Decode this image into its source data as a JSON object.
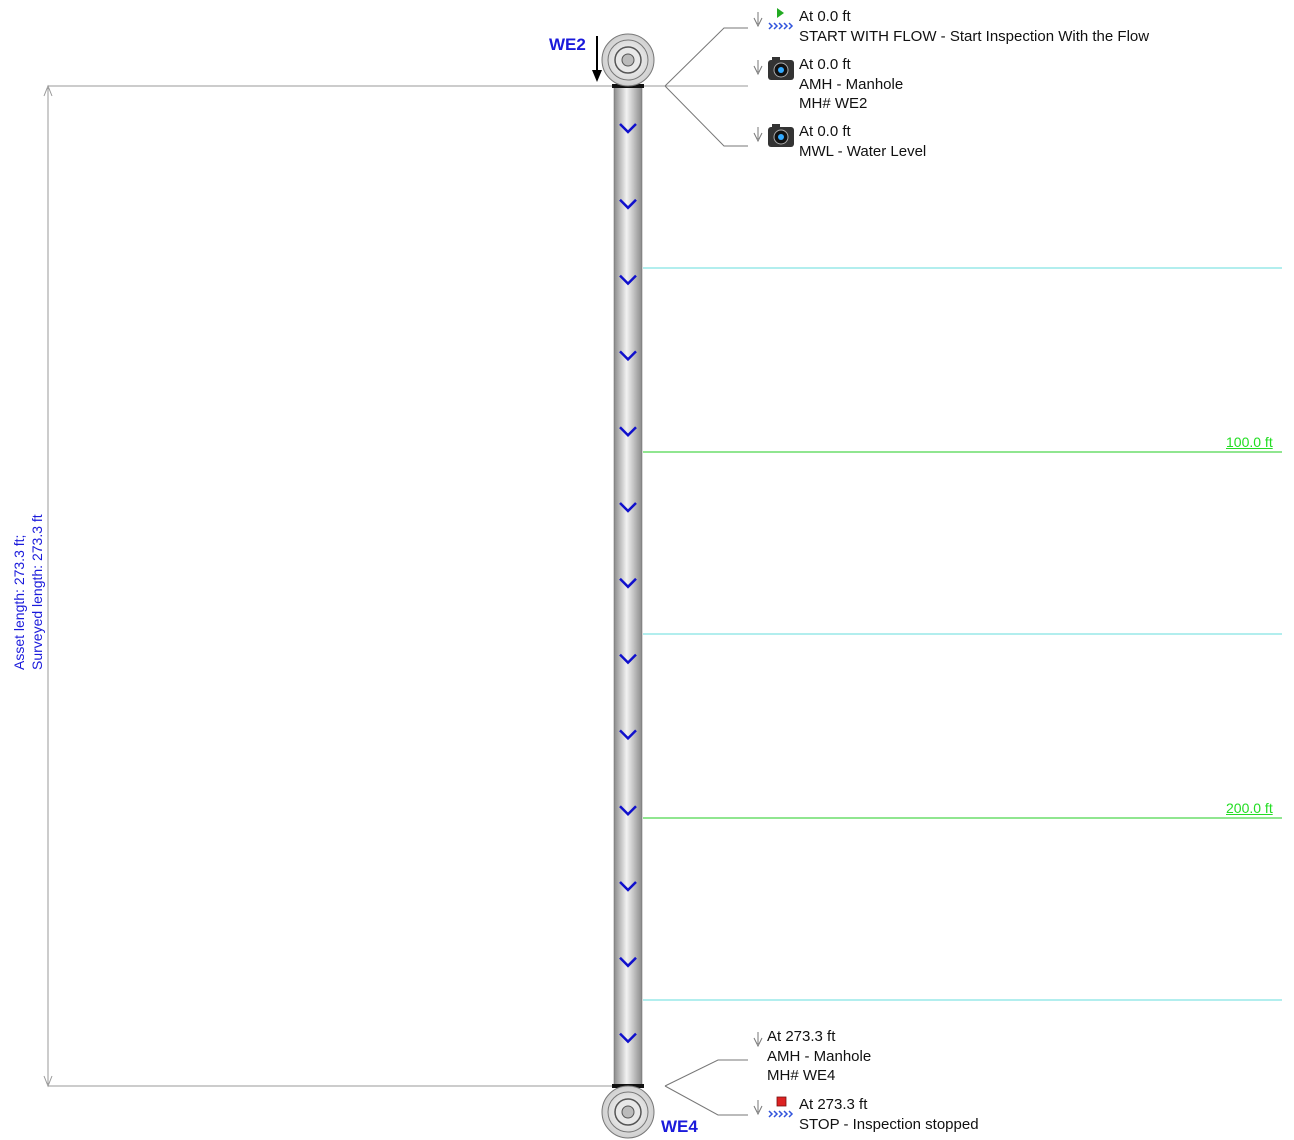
{
  "asset": {
    "upstream_manhole": "WE2",
    "downstream_manhole": "WE4",
    "length_label_line1": "Asset length: 273.3 ft;",
    "length_label_line2": "Surveyed length: 273.3 ft"
  },
  "distance_marks": [
    {
      "label": "100.0 ft"
    },
    {
      "label": "200.0 ft"
    }
  ],
  "observations": [
    {
      "at": "At 0.0 ft",
      "code": "START WITH FLOW - Start Inspection With the Flow",
      "extra": "",
      "icon": "start-flow-icon"
    },
    {
      "at": "At 0.0 ft",
      "code": "AMH - Manhole",
      "extra": "MH# WE2",
      "icon": "camera-icon"
    },
    {
      "at": "At 0.0 ft",
      "code": "MWL - Water Level",
      "extra": "",
      "icon": "camera-icon"
    },
    {
      "at": "At 273.3 ft",
      "code": "AMH - Manhole",
      "extra": "MH# WE4",
      "icon": ""
    },
    {
      "at": "At 273.3 ft",
      "code": "STOP - Inspection stopped",
      "extra": "",
      "icon": "stop-icon"
    }
  ],
  "colors": {
    "manhole_label": "#1a1adb",
    "distance_text": "#22dd22",
    "distance_line": "#22cc22",
    "grid_line": "#66dddd",
    "flow_chevron": "#1010cc"
  }
}
